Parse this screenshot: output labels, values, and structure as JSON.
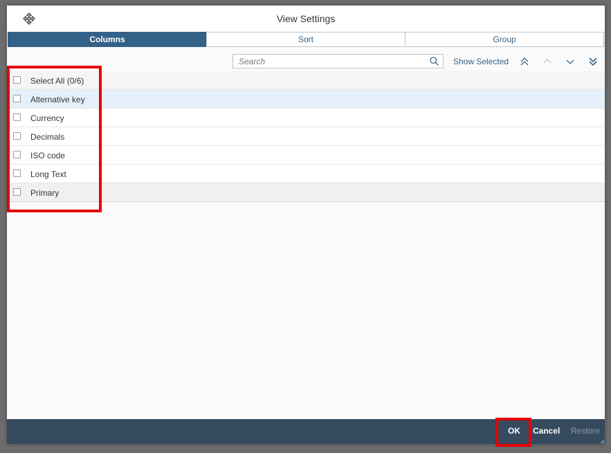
{
  "dialog": {
    "title": "View Settings",
    "tabs": [
      {
        "label": "Columns",
        "active": true
      },
      {
        "label": "Sort",
        "active": false
      },
      {
        "label": "Group",
        "active": false
      }
    ],
    "toolbar": {
      "search_placeholder": "Search",
      "search_value": "",
      "show_selected": "Show Selected"
    },
    "items": [
      {
        "label": "Select All (0/6)",
        "checked": false
      },
      {
        "label": "Alternative key",
        "checked": false
      },
      {
        "label": "Currency",
        "checked": false
      },
      {
        "label": "Decimals",
        "checked": false
      },
      {
        "label": "ISO code",
        "checked": false
      },
      {
        "label": "Long Text",
        "checked": false
      },
      {
        "label": "Primary",
        "checked": false
      }
    ],
    "footer": {
      "ok": "OK",
      "cancel": "Cancel",
      "restore": "Restore"
    }
  },
  "colors": {
    "accent": "#346187",
    "footer": "#354a5f",
    "highlight": "#e60000"
  }
}
